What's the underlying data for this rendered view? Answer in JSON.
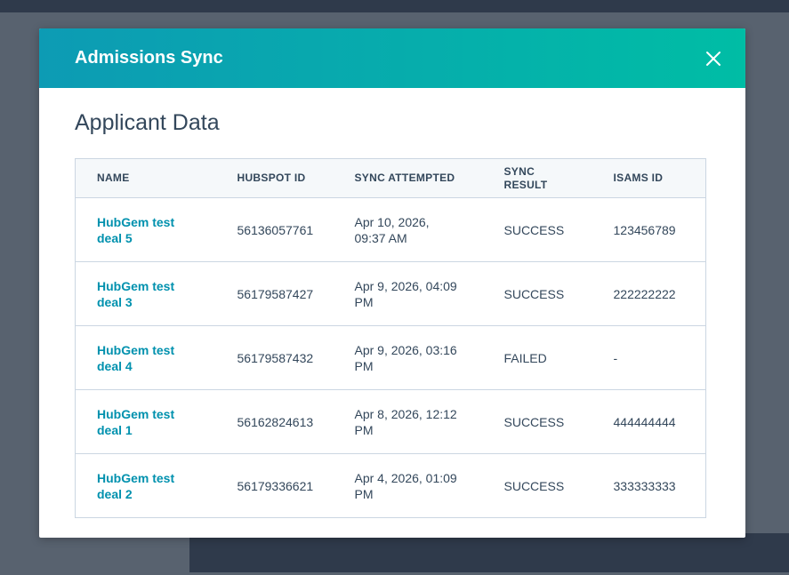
{
  "modal": {
    "title": "Admissions Sync"
  },
  "section": {
    "title": "Applicant Data"
  },
  "table": {
    "headers": {
      "name": "NAME",
      "hubspot_id": "HUBSPOT ID",
      "sync_attempted": "SYNC ATTEMPTED",
      "sync_result": "SYNC RESULT",
      "isams_id": "ISAMS ID"
    },
    "rows": [
      {
        "name": "HubGem test deal 5",
        "hubspot_id": "56136057761",
        "sync_attempted": "Apr 10, 2026, 09:37 AM",
        "sync_result": "SUCCESS",
        "isams_id": "123456789"
      },
      {
        "name": "HubGem test deal 3",
        "hubspot_id": "56179587427",
        "sync_attempted": "Apr 9, 2026, 04:09 PM",
        "sync_result": "SUCCESS",
        "isams_id": "222222222"
      },
      {
        "name": "HubGem test deal 4",
        "hubspot_id": "56179587432",
        "sync_attempted": "Apr 9, 2026, 03:16 PM",
        "sync_result": "FAILED",
        "isams_id": "-"
      },
      {
        "name": "HubGem test deal 1",
        "hubspot_id": "56162824613",
        "sync_attempted": "Apr 8, 2026, 12:12 PM",
        "sync_result": "SUCCESS",
        "isams_id": "444444444"
      },
      {
        "name": "HubGem test deal 2",
        "hubspot_id": "56179336621",
        "sync_attempted": "Apr 4, 2026, 01:09 PM",
        "sync_result": "SUCCESS",
        "isams_id": "333333333"
      }
    ]
  },
  "icons": {
    "close": "close-icon"
  },
  "colors": {
    "header_gradient_start": "#0d9bb4",
    "header_gradient_end": "#00bda5",
    "link": "#0091ae",
    "text": "#33475b"
  }
}
